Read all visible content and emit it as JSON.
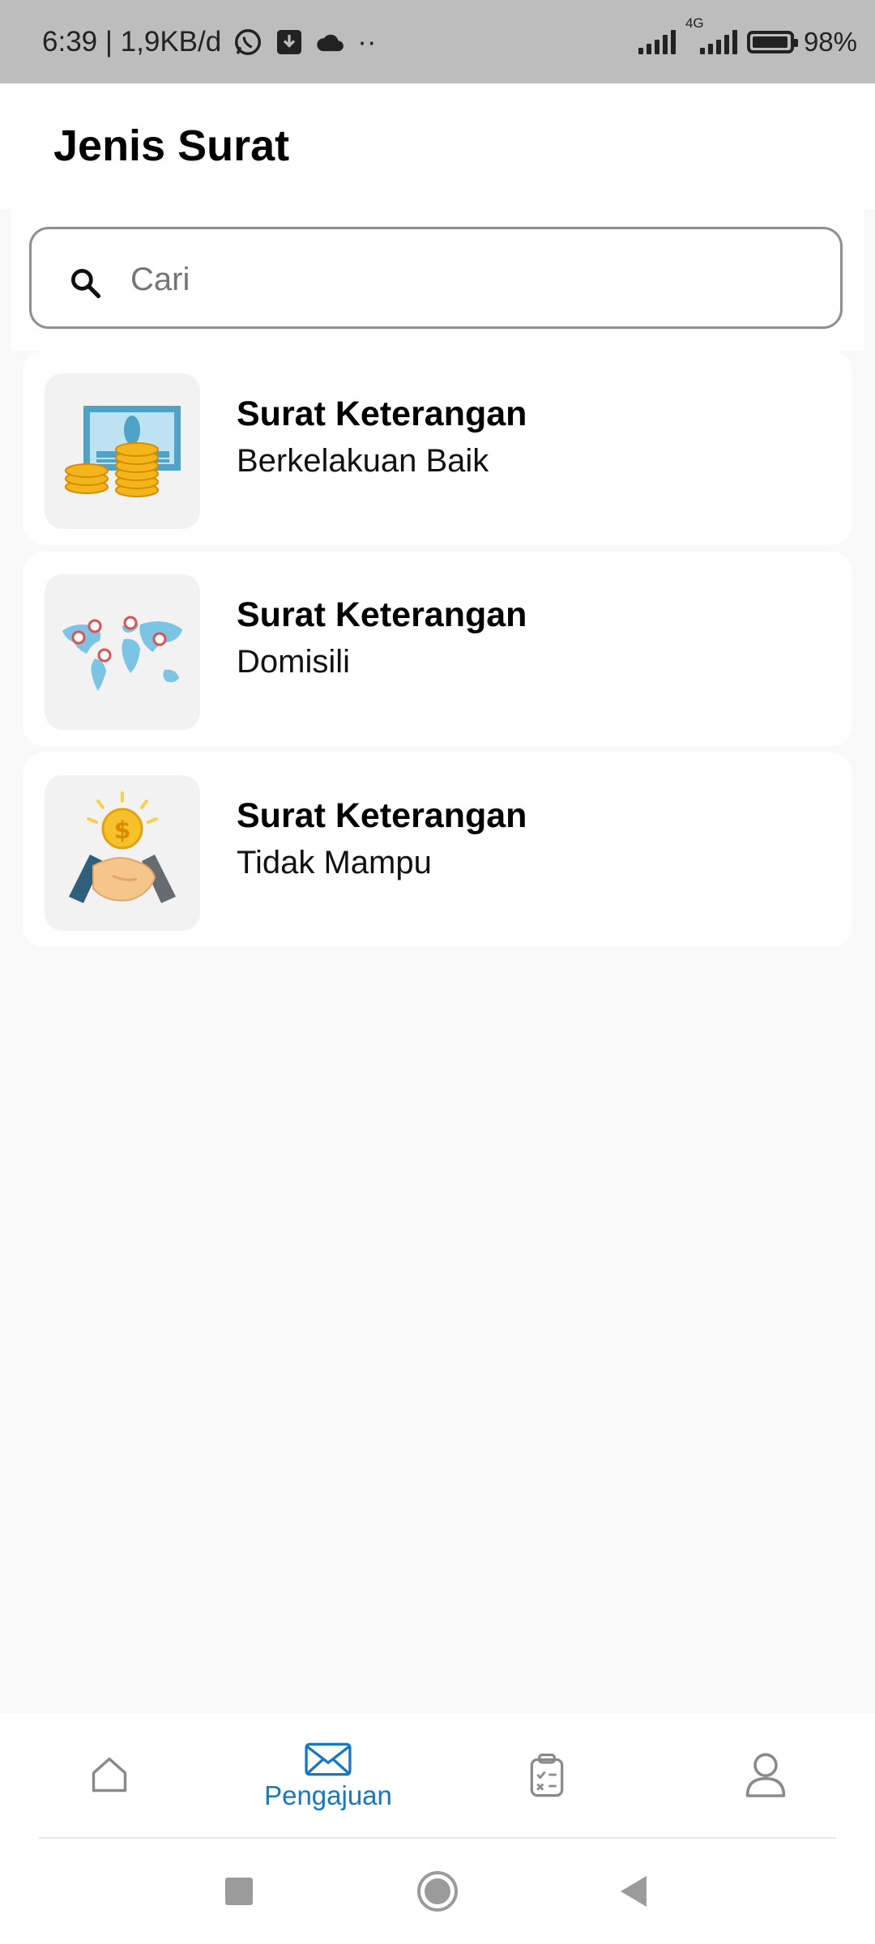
{
  "status_bar": {
    "time_info": "6:39 | 1,9KB/d",
    "dots": "··",
    "network": "4G",
    "battery": "98%",
    "battery_level": 0.98
  },
  "header": {
    "title": "Jenis Surat"
  },
  "search": {
    "placeholder": "Cari"
  },
  "letters": [
    {
      "title": "Surat Keterangan",
      "subtitle": "Berkelakuan Baik",
      "icon": "money-certificate-icon"
    },
    {
      "title": "Surat Keterangan",
      "subtitle": "Domisili",
      "icon": "world-map-icon"
    },
    {
      "title": "Surat Keterangan",
      "subtitle": "Tidak Mampu",
      "icon": "handshake-money-icon"
    }
  ],
  "bottom_nav": {
    "items": [
      {
        "name": "home",
        "label": "",
        "icon": "home-icon"
      },
      {
        "name": "pengajuan",
        "label": "Pengajuan",
        "icon": "envelope-icon",
        "active": true
      },
      {
        "name": "tasks",
        "label": "",
        "icon": "clipboard-check-icon"
      },
      {
        "name": "profile",
        "label": "",
        "icon": "user-icon"
      }
    ],
    "active_color": "#1677c4",
    "inactive_color": "#8a8a8a"
  },
  "system_nav": [
    "recents-button",
    "home-button",
    "back-button"
  ]
}
